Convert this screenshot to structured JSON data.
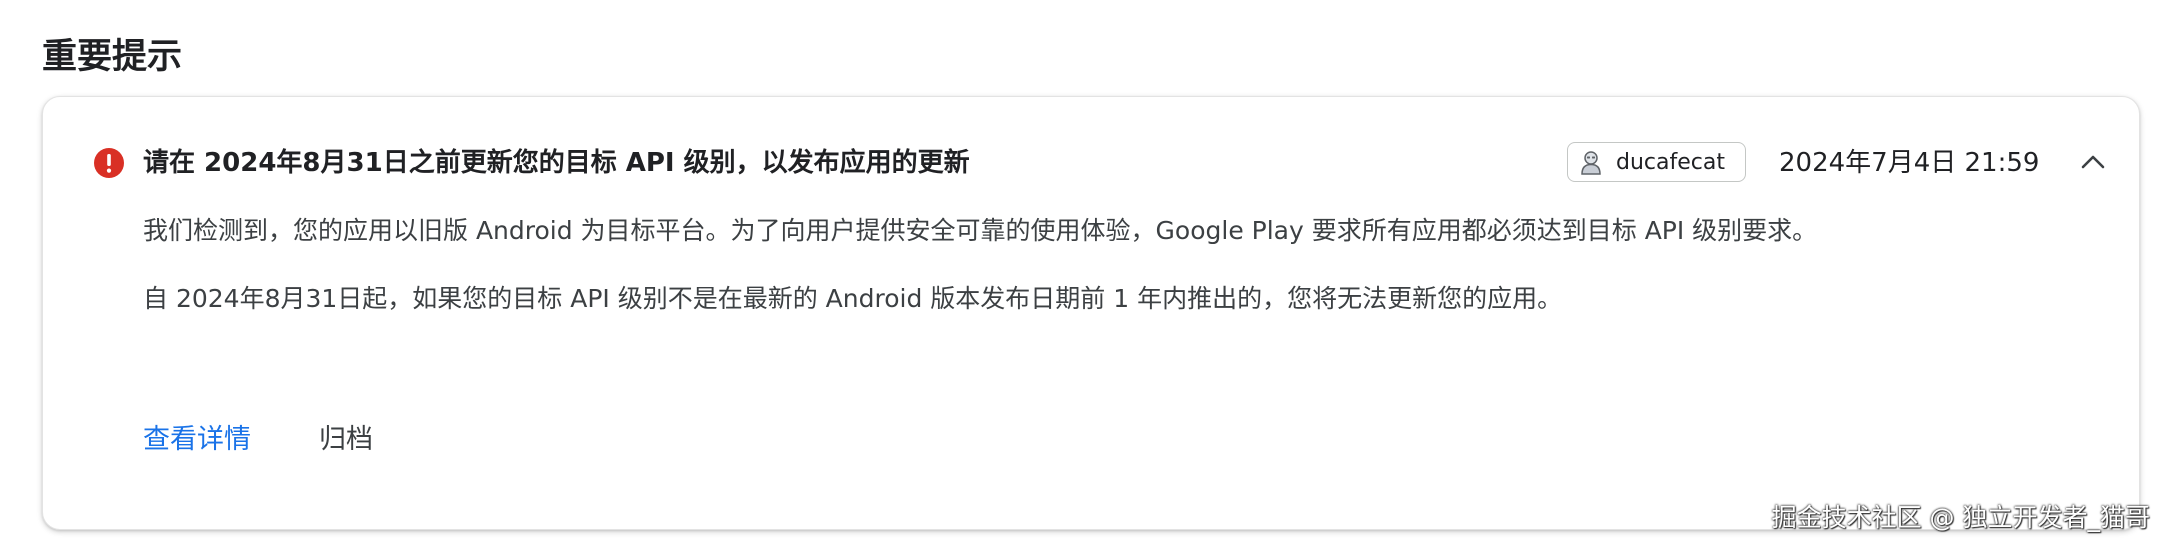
{
  "section": {
    "title": "重要提示"
  },
  "notice": {
    "severity_icon": "error-icon",
    "severity_color": "#d93025",
    "title": "请在 2024年8月31日之前更新您的目标 API 级别，以发布应用的更新",
    "owner": {
      "avatar_icon": "user-avatar-icon",
      "name": "ducafecat"
    },
    "timestamp": "2024年7月4日 21:59",
    "collapse_icon": "chevron-up-icon",
    "paragraphs": [
      "我们检测到，您的应用以旧版 Android 为目标平台。为了向用户提供安全可靠的使用体验，Google Play 要求所有应用都必须达到目标 API 级别要求。",
      "自 2024年8月31日起，如果您的目标 API 级别不是在最新的 Android 版本发布日期前 1 年内推出的，您将无法更新您的应用。"
    ],
    "actions": {
      "details_label": "查看详情",
      "archive_label": "归档"
    },
    "link_color": "#1a73e8"
  },
  "watermark": "掘金技术社区 @ 独立开发者_猫哥"
}
